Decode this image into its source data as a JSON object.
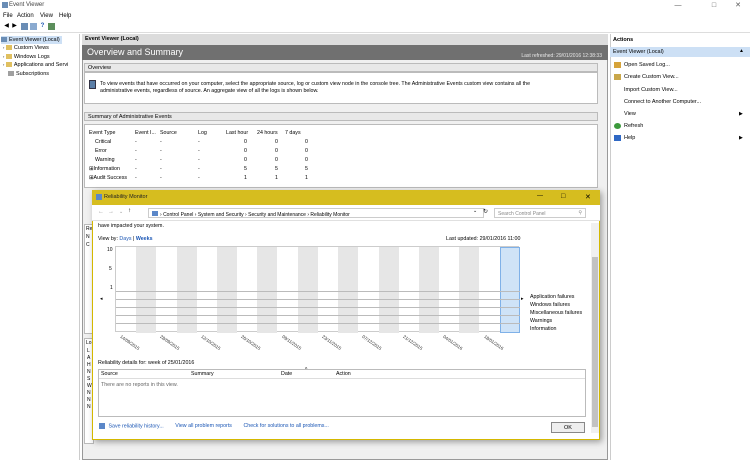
{
  "window": {
    "title": "Event Viewer",
    "min": "—",
    "max": "□",
    "close": "✕"
  },
  "menu": [
    "File",
    "Action",
    "View",
    "Help"
  ],
  "tree": [
    {
      "label": "Event Viewer (Local)",
      "selected": true
    },
    {
      "label": "Custom Views"
    },
    {
      "label": "Windows Logs"
    },
    {
      "label": "Applications and Servi"
    },
    {
      "label": "Subscriptions"
    }
  ],
  "center": {
    "header": "Event Viewer (Local)",
    "banner_title": "Overview and Summary",
    "last_refreshed": "Last refreshed: 29/01/2016 12:38:33",
    "overview_label": "Overview",
    "overview_text_1": "To view events that have occurred on your computer, select the appropriate source, log or custom view node in the console tree. The Administrative Events custom view contains all the",
    "overview_text_2": "administrative events, regardless of source. An aggregate view of all the logs is shown below.",
    "summary_label": "Summary of Administrative Events",
    "summary_headers": [
      "Event Type",
      "Event I...",
      "Source",
      "Log",
      "Last hour",
      "24 hours",
      "7 days"
    ],
    "summary_rows": [
      [
        "Critical",
        "-",
        "-",
        "-",
        "0",
        "0",
        "0"
      ],
      [
        "Error",
        "-",
        "-",
        "-",
        "0",
        "0",
        "0"
      ],
      [
        "Warning",
        "-",
        "-",
        "-",
        "0",
        "0",
        "0"
      ],
      [
        "Information",
        "-",
        "-",
        "-",
        "5",
        "5",
        "5"
      ],
      [
        "Audit Success",
        "-",
        "-",
        "-",
        "1",
        "1",
        "1"
      ]
    ],
    "side_letters": [
      "Re",
      "N",
      "C",
      "Lo",
      "L",
      "A",
      "H",
      "N",
      "S",
      "W",
      "N",
      "N",
      "N"
    ]
  },
  "actions": {
    "header": "Actions",
    "selected": "Event Viewer (Local)",
    "items": [
      "Open Saved Log...",
      "Create Custom View...",
      "Import Custom View...",
      "Connect to Another Computer...",
      "View",
      "Refresh",
      "Help"
    ]
  },
  "reliability": {
    "title": "Reliability Monitor",
    "breadcrumb": [
      "Control Panel",
      "System and Security",
      "Security and Maintenance",
      "Reliability Monitor"
    ],
    "search_placeholder": "Search Control Panel",
    "intro": "have impacted your system.",
    "view_by_label": "View by:",
    "view_days": "Days",
    "view_weeks": "Weeks",
    "last_updated": "Last updated: 29/01/2016 11:00",
    "y_labels": [
      "10",
      "5",
      "1"
    ],
    "legend": [
      "Application failures",
      "Windows failures",
      "Miscellaneous failures",
      "Warnings",
      "Information"
    ],
    "dates": [
      "14/09/2015",
      "28/09/2015",
      "12/10/2015",
      "26/10/2015",
      "09/11/2015",
      "23/11/2015",
      "07/12/2015",
      "21/12/2015",
      "04/01/2016",
      "18/01/2016"
    ],
    "details_label": "Reliability details for: week of 25/01/2016",
    "details_headers": [
      "Source",
      "Summary",
      "Date",
      "Action"
    ],
    "details_empty": "There are no reports in this view.",
    "footer_links": [
      "Save reliability history...",
      "View all problem reports",
      "Check for solutions to all problems..."
    ],
    "ok": "OK"
  }
}
